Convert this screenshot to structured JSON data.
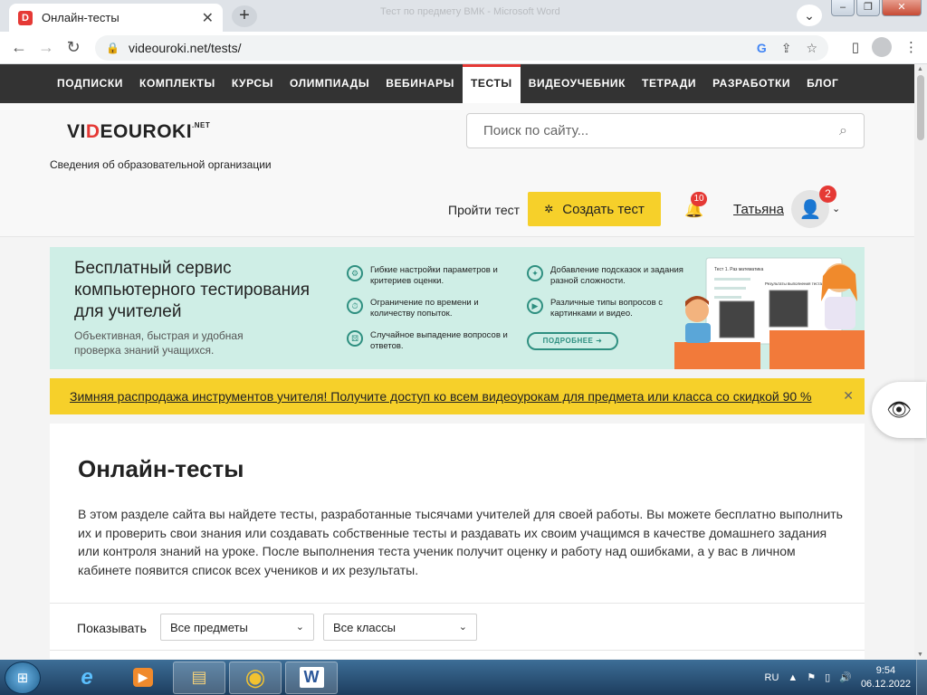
{
  "browser": {
    "tab_title": "Онлайн-тесты",
    "tab_favicon": "D",
    "tab_close": "✕",
    "new_tab": "+",
    "window_title": "Тест по предмету ВМК - Microsoft Word",
    "url": "videouroki.net/tests/",
    "lock": "🔒",
    "icons": {
      "back": "←",
      "forward": "→",
      "reload": "↻",
      "google": "G",
      "share": "⇪",
      "star": "☆",
      "sidepanel": "▯",
      "menu": "⋮",
      "tab_search": "⌄"
    },
    "window_controls": {
      "minimize": "–",
      "restore": "❐",
      "close": "✕"
    }
  },
  "sitenav": {
    "items": [
      "ПОДПИСКИ",
      "КОМПЛЕКТЫ",
      "КУРСЫ",
      "ОЛИМПИАДЫ",
      "ВЕБИНАРЫ",
      "ТЕСТЫ",
      "ВИДЕОУЧЕБНИК",
      "ТЕТРАДИ",
      "РАЗРАБОТКИ",
      "БЛОГ"
    ],
    "active": "ТЕСТЫ"
  },
  "header": {
    "logo_prefix": "VI",
    "logo_accent": "D",
    "logo_suffix": "EOUROKI",
    "logo_sup": ".NET",
    "org_link": "Сведения об образовательной организации",
    "search_placeholder": "Поиск по сайту...",
    "search_icon": "⌕",
    "take_test": "Пройти тест",
    "create_test": "Создать тест",
    "create_icon": "✲",
    "bell_icon": "🔔",
    "bell_count": "10",
    "username": "Татьяна",
    "avatar_icon": "👤",
    "avatar_badge": "2",
    "caret": "⌄"
  },
  "banner": {
    "title": "Бесплатный сервис компьютерного тестирования для учителей",
    "subtitle": "Объективная, быстрая и удобная проверка знаний учащихся.",
    "features": [
      {
        "icon": "⚙",
        "text": "Гибкие настройки параметров и критериев оценки."
      },
      {
        "icon": "⏱",
        "text": "Ограничение по времени и количеству попыток."
      },
      {
        "icon": "⚄",
        "text": "Случайное выпадение вопросов и ответов."
      },
      {
        "icon": "✦",
        "text": "Добавление подсказок и задания разной сложности."
      },
      {
        "icon": "▶",
        "text": "Различные типы вопросов с картинками и видео."
      }
    ],
    "more_button": "ПОДРОБНЕЕ ➜",
    "illus_text_1": "Тест 1. Раз математика",
    "illus_text_2": "Результаты выполнения теста"
  },
  "promo": {
    "text": "Зимняя распродажа инструментов учителя! Получите доступ ко всем видеоурокам для предмета или класса со скидкой 90 %",
    "close": "✕"
  },
  "main": {
    "title": "Онлайн-тесты",
    "description": "В этом разделе сайта вы найдете тесты, разработанные тысячами учителей для своей работы. Вы можете бесплатно выполнить их и проверить свои знания или создавать собственные тесты и раздавать их своим учащимся в качестве домашнего задания или контроля знаний на уроке. После выполнения теста ученик получит оценку и работу над ошибками, а у вас в личном кабинете появится список всех учеников и их результаты.",
    "filter_label": "Показывать",
    "subject_select": "Все предметы",
    "class_select": "Все классы",
    "select_caret": "⌄"
  },
  "side_widget": {
    "icon": "👁"
  },
  "taskbar": {
    "start_icon": "⊞",
    "apps": [
      {
        "name": "ie",
        "icon": "e"
      },
      {
        "name": "media-player",
        "icon": "▶"
      },
      {
        "name": "explorer",
        "icon": "▤"
      },
      {
        "name": "chrome",
        "icon": "◉"
      },
      {
        "name": "word",
        "icon": "W"
      }
    ],
    "language": "RU",
    "tray_icons": [
      "▲",
      "⚑",
      "▯",
      "🔊"
    ],
    "time": "9:54",
    "date": "06.12.2022"
  },
  "colors": {
    "accent_red": "#e53935",
    "accent_yellow": "#f6d02a",
    "banner_bg": "#cfeee6",
    "teal": "#2e8f80",
    "nav_dark": "#333333"
  }
}
